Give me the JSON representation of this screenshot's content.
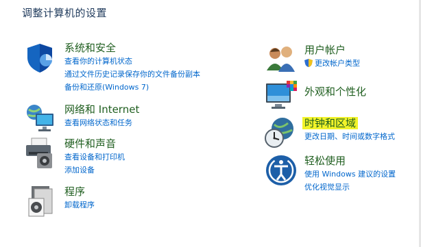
{
  "window": {
    "title": "调整计算机的设置"
  },
  "categories_left": [
    {
      "title": "系统和安全",
      "icon": "shield-icon",
      "links": [
        "查看你的计算机状态",
        "通过文件历史记录保存你的文件备份副本",
        "备份和还原(Windows 7)"
      ]
    },
    {
      "title": "网络和 Internet",
      "icon": "network-globe-icon",
      "links": [
        "查看网络状态和任务"
      ]
    },
    {
      "title": "硬件和声音",
      "icon": "printer-icon",
      "links": [
        "查看设备和打印机",
        "添加设备"
      ]
    },
    {
      "title": "程序",
      "icon": "programs-icon",
      "links": [
        "卸载程序"
      ]
    }
  ],
  "categories_right": [
    {
      "title": "用户帐户",
      "icon": "user-accounts-icon",
      "links": [
        "更改帐户类型"
      ]
    },
    {
      "title": "外观和个性化",
      "icon": "monitor-appearance-icon",
      "links": []
    },
    {
      "title": "时钟和区域",
      "icon": "clock-globe-icon",
      "highlighted": true,
      "highlight_color": "#f2f32a",
      "links": [
        "更改日期、时间或数字格式"
      ]
    },
    {
      "title": "轻松使用",
      "icon": "ease-of-access-icon",
      "links": [
        "使用 Windows 建议的设置",
        "优化视觉显示"
      ]
    }
  ],
  "colors": {
    "heading": "#1f5e1f",
    "link": "#0066cc",
    "title": "#1e395b"
  }
}
